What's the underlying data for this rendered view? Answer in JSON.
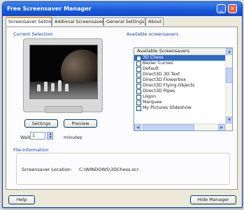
{
  "window": {
    "title": "Free Screensaver Manager"
  },
  "tabs": [
    {
      "label": "Screensaver Settings"
    },
    {
      "label": "Addional Screensavers"
    },
    {
      "label": "General Settings"
    },
    {
      "label": "About"
    }
  ],
  "current_selection": {
    "group_label": "Current Selection",
    "settings_label": "Settings",
    "preview_label": "Preview",
    "wait_label": "Wait",
    "wait_value": "1",
    "minutes_label": "minutes"
  },
  "available": {
    "group_label": "Available screensavers",
    "column_header": "Available Screensavers",
    "items": [
      {
        "label": "3D Chess",
        "checked": true,
        "selected": true
      },
      {
        "label": "Bezier Curves",
        "checked": false
      },
      {
        "label": "Default",
        "checked": false
      },
      {
        "label": "Direct3D 3D Text",
        "checked": false
      },
      {
        "label": "Direct3D Flowerbox",
        "checked": false
      },
      {
        "label": "Direct3D Flying Objects",
        "checked": false
      },
      {
        "label": "Direct3D Pipes",
        "checked": false
      },
      {
        "label": "Logon",
        "checked": false
      },
      {
        "label": "Marquee",
        "checked": false
      },
      {
        "label": "My Pictures Slideshow",
        "checked": false
      }
    ]
  },
  "file_information": {
    "group_label": "File Information",
    "location_label": "Screensaver Location:",
    "location_value": "C:\\WINDOWS\\3DChess.scr"
  },
  "footer": {
    "help_label": "Help",
    "hide_label": "Hide Manager"
  },
  "colors": {
    "titlebar": "#0b47cf",
    "selection": "#316ac5",
    "group_label": "#1c3f9f"
  }
}
